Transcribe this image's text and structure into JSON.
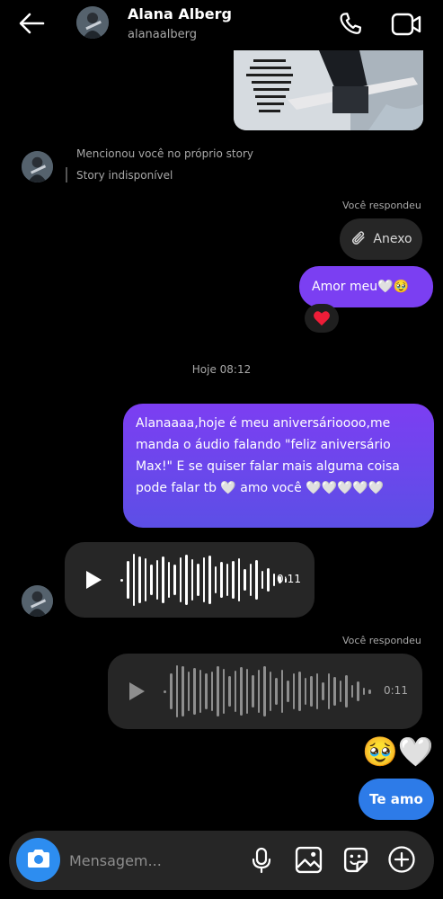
{
  "header": {
    "name": "Alana Alberg",
    "username": "alanaalberg"
  },
  "messages": {
    "mention_text": "Mencionou você no próprio story",
    "story_unavailable": "Story indisponível",
    "you_replied_1": "Você respondeu",
    "attachment_label": "Anexo",
    "amor_meu": "Amor meu🤍🥹",
    "reaction": "❤️",
    "time_separator": "Hoje 08:12",
    "long_message": "Alanaaaa,hoje é meu aniversárioooo,me manda o áudio falando \"feliz aniversário Max!\" E se quiser falar mais alguma coisa pode falar tb 🤍 amo você 🤍🤍🤍🤍🤍",
    "audio_in_duration": "0:11",
    "you_replied_2": "Você respondeu",
    "audio_out_duration": "0:11",
    "emoji_message": "🥹🤍",
    "te_amo": "Te amo"
  },
  "composer": {
    "placeholder": "Mensagem..."
  },
  "colors": {
    "background": "#000000",
    "sent_bubble": "#7b3ff2",
    "sent_gradient_end": "#5c4fe6",
    "blue_bubble": "#2d7be8",
    "received_bubble": "#262626",
    "camera_button": "#2d8df0",
    "secondary_text": "#a8a8a8"
  },
  "icons": [
    "back-arrow-icon",
    "phone-icon",
    "video-camera-icon",
    "paperclip-icon",
    "heart-icon",
    "play-icon",
    "camera-icon",
    "microphone-icon",
    "gallery-icon",
    "sticker-icon",
    "plus-icon"
  ]
}
